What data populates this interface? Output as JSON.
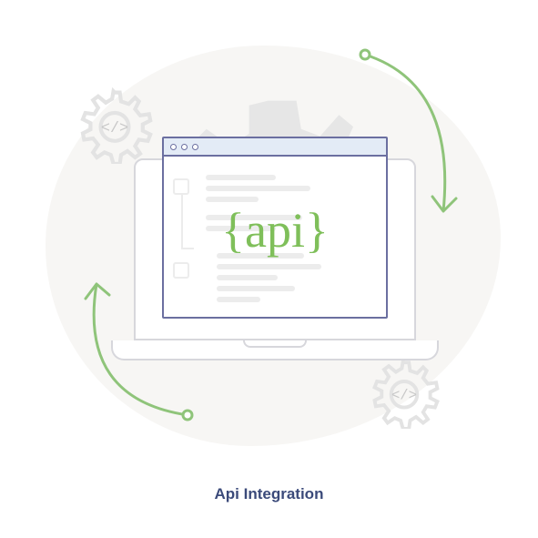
{
  "caption": "Api Integration",
  "browser": {
    "api_label": "{api}"
  },
  "gears": {
    "code_glyph": "</>"
  }
}
